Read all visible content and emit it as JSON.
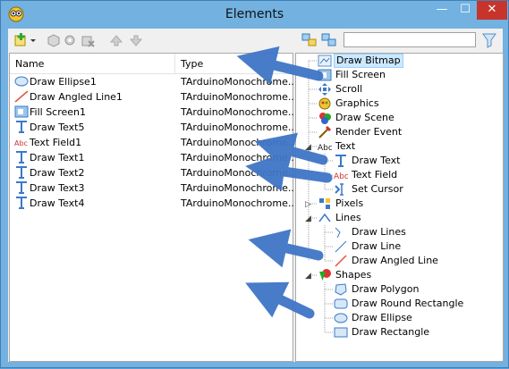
{
  "window": {
    "title": "Elements",
    "minimize": "—",
    "maximize": "☐",
    "close": "✕"
  },
  "search": {
    "placeholder": "",
    "value": ""
  },
  "grid": {
    "headers": {
      "name": "Name",
      "type": "Type"
    },
    "rows": [
      {
        "icon": "ellipse-icon",
        "name": "Draw Ellipse1",
        "type": "TArduinoMonochrome..."
      },
      {
        "icon": "angled-line-icon",
        "name": "Draw Angled Line1",
        "type": "TArduinoMonochrome..."
      },
      {
        "icon": "fill-screen-icon",
        "name": "Fill Screen1",
        "type": "TArduinoMonochrome..."
      },
      {
        "icon": "draw-text-icon",
        "name": "Draw Text5",
        "type": "TArduinoMonochrome..."
      },
      {
        "icon": "text-field-icon",
        "name": "Text Field1",
        "type": "TArduinoMonochrome..."
      },
      {
        "icon": "draw-text-icon",
        "name": "Draw Text1",
        "type": "TArduinoMonochrome..."
      },
      {
        "icon": "draw-text-icon",
        "name": "Draw Text2",
        "type": "TArduinoMonochrome..."
      },
      {
        "icon": "draw-text-icon",
        "name": "Draw Text3",
        "type": "TArduinoMonochrome..."
      },
      {
        "icon": "draw-text-icon",
        "name": "Draw Text4",
        "type": "TArduinoMonochrome..."
      }
    ]
  },
  "tree": {
    "draw_bitmap": "Draw Bitmap",
    "fill_screen": "Fill Screen",
    "scroll": "Scroll",
    "graphics": "Graphics",
    "draw_scene": "Draw Scene",
    "render_event": "Render Event",
    "text": "Text",
    "draw_text": "Draw Text",
    "text_field": "Text Field",
    "set_cursor": "Set Cursor",
    "pixels": "Pixels",
    "lines": "Lines",
    "draw_lines": "Draw Lines",
    "draw_line": "Draw Line",
    "draw_angled_line": "Draw Angled Line",
    "shapes": "Shapes",
    "draw_polygon": "Draw Polygon",
    "draw_round_rectangle": "Draw Round Rectangle",
    "draw_ellipse": "Draw Ellipse",
    "draw_rectangle": "Draw Rectangle"
  },
  "colors": {
    "accent": "#3b79c9",
    "selection": "#cce8ff",
    "close": "#c7342b",
    "window_frame": "#72b1e0"
  }
}
